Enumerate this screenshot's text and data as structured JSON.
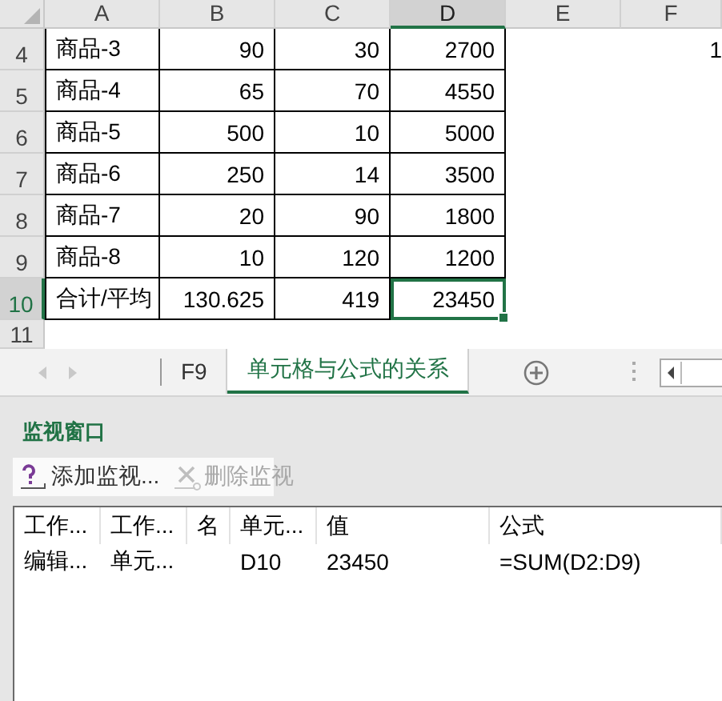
{
  "columns": [
    {
      "label": "A",
      "selected": false
    },
    {
      "label": "B",
      "selected": false
    },
    {
      "label": "C",
      "selected": false
    },
    {
      "label": "D",
      "selected": true
    },
    {
      "label": "E",
      "selected": false
    },
    {
      "label": "F",
      "selected": false
    }
  ],
  "rows": [
    {
      "number": "4",
      "selected": false,
      "cells": [
        {
          "text": "商品-3",
          "selected": false
        },
        {
          "text": "90",
          "selected": false
        },
        {
          "text": "30",
          "selected": false
        },
        {
          "text": "2700",
          "selected": false
        }
      ],
      "column_f": "1"
    },
    {
      "number": "5",
      "selected": false,
      "cells": [
        {
          "text": "商品-4",
          "selected": false
        },
        {
          "text": "65",
          "selected": false
        },
        {
          "text": "70",
          "selected": false
        },
        {
          "text": "4550",
          "selected": false
        }
      ]
    },
    {
      "number": "6",
      "selected": false,
      "cells": [
        {
          "text": "商品-5",
          "selected": false
        },
        {
          "text": "500",
          "selected": false
        },
        {
          "text": "10",
          "selected": false
        },
        {
          "text": "5000",
          "selected": false
        }
      ]
    },
    {
      "number": "7",
      "selected": false,
      "cells": [
        {
          "text": "商品-6",
          "selected": false
        },
        {
          "text": "250",
          "selected": false
        },
        {
          "text": "14",
          "selected": false
        },
        {
          "text": "3500",
          "selected": false
        }
      ]
    },
    {
      "number": "8",
      "selected": false,
      "cells": [
        {
          "text": "商品-7",
          "selected": false
        },
        {
          "text": "20",
          "selected": false
        },
        {
          "text": "90",
          "selected": false
        },
        {
          "text": "1800",
          "selected": false
        }
      ]
    },
    {
      "number": "9",
      "selected": false,
      "cells": [
        {
          "text": "商品-8",
          "selected": false
        },
        {
          "text": "10",
          "selected": false
        },
        {
          "text": "120",
          "selected": false
        },
        {
          "text": "1200",
          "selected": false
        }
      ]
    },
    {
      "number": "10",
      "selected": true,
      "cells": [
        {
          "text": "合计/平均",
          "selected": false
        },
        {
          "text": "130.625",
          "selected": false
        },
        {
          "text": "419",
          "selected": false
        },
        {
          "text": "23450",
          "selected": true
        }
      ]
    },
    {
      "number": "11",
      "selected": false
    }
  ],
  "sheet_tabs": [
    {
      "label": "F9",
      "selected": false
    },
    {
      "label": "单元格与公式的关系",
      "selected": true
    }
  ],
  "watch_window": {
    "title": "监视窗口",
    "toolbar": [
      {
        "label": "添加监视...",
        "disabled": false
      },
      {
        "label": "删除监视",
        "disabled": true
      }
    ],
    "columns": [
      "工作...",
      "工作...",
      "名",
      "单元...",
      "值",
      "公式"
    ],
    "rows": [
      {
        "workbook": "编辑...",
        "sheet": "单元...",
        "cell": "D10",
        "value": "23450",
        "formula": "=SUM(D2:D9)"
      }
    ]
  }
}
